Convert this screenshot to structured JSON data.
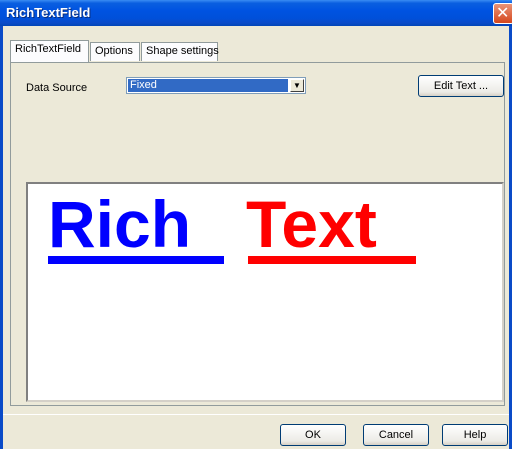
{
  "window": {
    "title": "RichTextField"
  },
  "tabs": [
    {
      "label": "RichTextField",
      "active": true
    },
    {
      "label": "Options",
      "active": false
    },
    {
      "label": "Shape settings",
      "active": false
    }
  ],
  "data_source": {
    "label": "Data Source",
    "selected": "Fixed"
  },
  "edit_text_button": "Edit Text ...",
  "preview": {
    "words": [
      {
        "text": "Rich",
        "color": "#0000FF"
      },
      {
        "text": "Text",
        "color": "#FF0000"
      }
    ]
  },
  "footer": {
    "ok": "OK",
    "cancel": "Cancel",
    "help": "Help"
  },
  "colors": {
    "title_bar": "#0053E1",
    "selection": "#316AC5"
  }
}
